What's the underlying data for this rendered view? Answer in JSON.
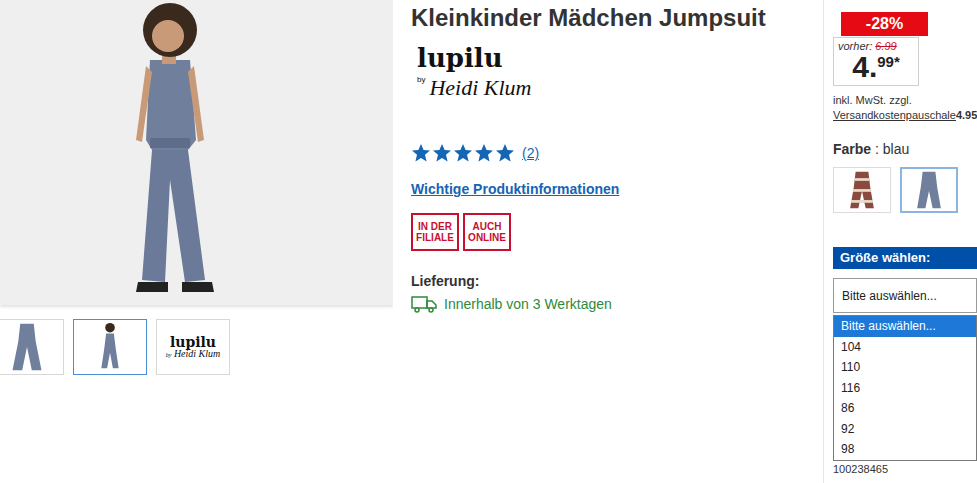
{
  "gallery": {
    "thumbnails": [
      {
        "kind": "product",
        "selected": false
      },
      {
        "kind": "model",
        "selected": true
      },
      {
        "kind": "logo",
        "selected": false
      }
    ]
  },
  "product": {
    "title": "Kleinkinder Mädchen Jumpsuit",
    "brand": {
      "name": "lupilu",
      "by": "by",
      "signature": "Heidi Klum"
    },
    "rating": {
      "stars": 5,
      "count": "(2)"
    },
    "info_link": "Wichtige Produktinformationen",
    "badges": [
      {
        "lines": [
          "IN DER",
          "FILIALE"
        ]
      },
      {
        "lines": [
          "AUCH",
          "ONLINE"
        ]
      }
    ],
    "delivery": {
      "label": "Lieferung:",
      "text": "Innerhalb von 3 Werktagen"
    }
  },
  "price": {
    "discount": "-28%",
    "before_label": "vorher:",
    "before": "6.99",
    "current_main": "4.",
    "current_cents": "99",
    "asterisk": "*",
    "tax_note": "inkl. MwSt. zzgl.",
    "shipping_link": "Versandkostenpauschale",
    "shipping_fee": "4.95"
  },
  "color": {
    "label": "Farbe",
    "separator": ":",
    "value": "blau",
    "swatches": [
      {
        "kind": "pattern",
        "selected": false
      },
      {
        "kind": "plain",
        "selected": true
      }
    ]
  },
  "size": {
    "label": "Größe wählen:",
    "select": {
      "value": "Bitte auswählen...",
      "open": true
    },
    "options": [
      {
        "label": "Bitte auswählen...",
        "selected": true
      },
      {
        "label": "104",
        "selected": false
      },
      {
        "label": "110",
        "selected": false
      },
      {
        "label": "116",
        "selected": false
      },
      {
        "label": "86",
        "selected": false
      },
      {
        "label": "92",
        "selected": false
      },
      {
        "label": "98",
        "selected": false
      }
    ]
  },
  "article_number": "100238465"
}
